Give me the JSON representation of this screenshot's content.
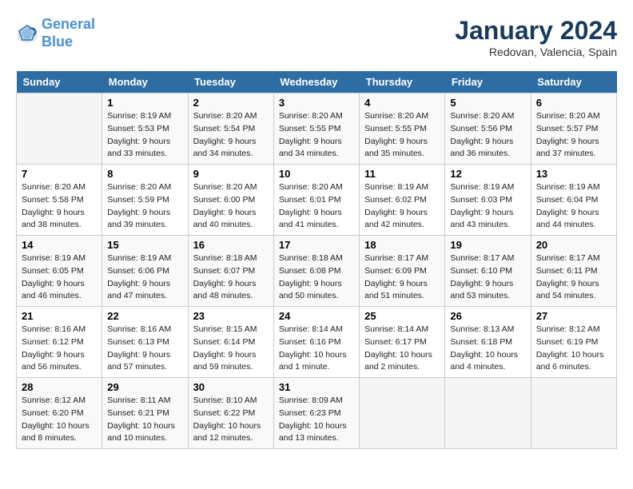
{
  "header": {
    "logo_line1": "General",
    "logo_line2": "Blue",
    "month": "January 2024",
    "location": "Redovan, Valencia, Spain"
  },
  "weekdays": [
    "Sunday",
    "Monday",
    "Tuesday",
    "Wednesday",
    "Thursday",
    "Friday",
    "Saturday"
  ],
  "weeks": [
    [
      {
        "day": "",
        "lines": []
      },
      {
        "day": "1",
        "lines": [
          "Sunrise: 8:19 AM",
          "Sunset: 5:53 PM",
          "Daylight: 9 hours",
          "and 33 minutes."
        ]
      },
      {
        "day": "2",
        "lines": [
          "Sunrise: 8:20 AM",
          "Sunset: 5:54 PM",
          "Daylight: 9 hours",
          "and 34 minutes."
        ]
      },
      {
        "day": "3",
        "lines": [
          "Sunrise: 8:20 AM",
          "Sunset: 5:55 PM",
          "Daylight: 9 hours",
          "and 34 minutes."
        ]
      },
      {
        "day": "4",
        "lines": [
          "Sunrise: 8:20 AM",
          "Sunset: 5:55 PM",
          "Daylight: 9 hours",
          "and 35 minutes."
        ]
      },
      {
        "day": "5",
        "lines": [
          "Sunrise: 8:20 AM",
          "Sunset: 5:56 PM",
          "Daylight: 9 hours",
          "and 36 minutes."
        ]
      },
      {
        "day": "6",
        "lines": [
          "Sunrise: 8:20 AM",
          "Sunset: 5:57 PM",
          "Daylight: 9 hours",
          "and 37 minutes."
        ]
      }
    ],
    [
      {
        "day": "7",
        "lines": [
          "Sunrise: 8:20 AM",
          "Sunset: 5:58 PM",
          "Daylight: 9 hours",
          "and 38 minutes."
        ]
      },
      {
        "day": "8",
        "lines": [
          "Sunrise: 8:20 AM",
          "Sunset: 5:59 PM",
          "Daylight: 9 hours",
          "and 39 minutes."
        ]
      },
      {
        "day": "9",
        "lines": [
          "Sunrise: 8:20 AM",
          "Sunset: 6:00 PM",
          "Daylight: 9 hours",
          "and 40 minutes."
        ]
      },
      {
        "day": "10",
        "lines": [
          "Sunrise: 8:20 AM",
          "Sunset: 6:01 PM",
          "Daylight: 9 hours",
          "and 41 minutes."
        ]
      },
      {
        "day": "11",
        "lines": [
          "Sunrise: 8:19 AM",
          "Sunset: 6:02 PM",
          "Daylight: 9 hours",
          "and 42 minutes."
        ]
      },
      {
        "day": "12",
        "lines": [
          "Sunrise: 8:19 AM",
          "Sunset: 6:03 PM",
          "Daylight: 9 hours",
          "and 43 minutes."
        ]
      },
      {
        "day": "13",
        "lines": [
          "Sunrise: 8:19 AM",
          "Sunset: 6:04 PM",
          "Daylight: 9 hours",
          "and 44 minutes."
        ]
      }
    ],
    [
      {
        "day": "14",
        "lines": [
          "Sunrise: 8:19 AM",
          "Sunset: 6:05 PM",
          "Daylight: 9 hours",
          "and 46 minutes."
        ]
      },
      {
        "day": "15",
        "lines": [
          "Sunrise: 8:19 AM",
          "Sunset: 6:06 PM",
          "Daylight: 9 hours",
          "and 47 minutes."
        ]
      },
      {
        "day": "16",
        "lines": [
          "Sunrise: 8:18 AM",
          "Sunset: 6:07 PM",
          "Daylight: 9 hours",
          "and 48 minutes."
        ]
      },
      {
        "day": "17",
        "lines": [
          "Sunrise: 8:18 AM",
          "Sunset: 6:08 PM",
          "Daylight: 9 hours",
          "and 50 minutes."
        ]
      },
      {
        "day": "18",
        "lines": [
          "Sunrise: 8:17 AM",
          "Sunset: 6:09 PM",
          "Daylight: 9 hours",
          "and 51 minutes."
        ]
      },
      {
        "day": "19",
        "lines": [
          "Sunrise: 8:17 AM",
          "Sunset: 6:10 PM",
          "Daylight: 9 hours",
          "and 53 minutes."
        ]
      },
      {
        "day": "20",
        "lines": [
          "Sunrise: 8:17 AM",
          "Sunset: 6:11 PM",
          "Daylight: 9 hours",
          "and 54 minutes."
        ]
      }
    ],
    [
      {
        "day": "21",
        "lines": [
          "Sunrise: 8:16 AM",
          "Sunset: 6:12 PM",
          "Daylight: 9 hours",
          "and 56 minutes."
        ]
      },
      {
        "day": "22",
        "lines": [
          "Sunrise: 8:16 AM",
          "Sunset: 6:13 PM",
          "Daylight: 9 hours",
          "and 57 minutes."
        ]
      },
      {
        "day": "23",
        "lines": [
          "Sunrise: 8:15 AM",
          "Sunset: 6:14 PM",
          "Daylight: 9 hours",
          "and 59 minutes."
        ]
      },
      {
        "day": "24",
        "lines": [
          "Sunrise: 8:14 AM",
          "Sunset: 6:16 PM",
          "Daylight: 10 hours",
          "and 1 minute."
        ]
      },
      {
        "day": "25",
        "lines": [
          "Sunrise: 8:14 AM",
          "Sunset: 6:17 PM",
          "Daylight: 10 hours",
          "and 2 minutes."
        ]
      },
      {
        "day": "26",
        "lines": [
          "Sunrise: 8:13 AM",
          "Sunset: 6:18 PM",
          "Daylight: 10 hours",
          "and 4 minutes."
        ]
      },
      {
        "day": "27",
        "lines": [
          "Sunrise: 8:12 AM",
          "Sunset: 6:19 PM",
          "Daylight: 10 hours",
          "and 6 minutes."
        ]
      }
    ],
    [
      {
        "day": "28",
        "lines": [
          "Sunrise: 8:12 AM",
          "Sunset: 6:20 PM",
          "Daylight: 10 hours",
          "and 8 minutes."
        ]
      },
      {
        "day": "29",
        "lines": [
          "Sunrise: 8:11 AM",
          "Sunset: 6:21 PM",
          "Daylight: 10 hours",
          "and 10 minutes."
        ]
      },
      {
        "day": "30",
        "lines": [
          "Sunrise: 8:10 AM",
          "Sunset: 6:22 PM",
          "Daylight: 10 hours",
          "and 12 minutes."
        ]
      },
      {
        "day": "31",
        "lines": [
          "Sunrise: 8:09 AM",
          "Sunset: 6:23 PM",
          "Daylight: 10 hours",
          "and 13 minutes."
        ]
      },
      {
        "day": "",
        "lines": []
      },
      {
        "day": "",
        "lines": []
      },
      {
        "day": "",
        "lines": []
      }
    ]
  ]
}
